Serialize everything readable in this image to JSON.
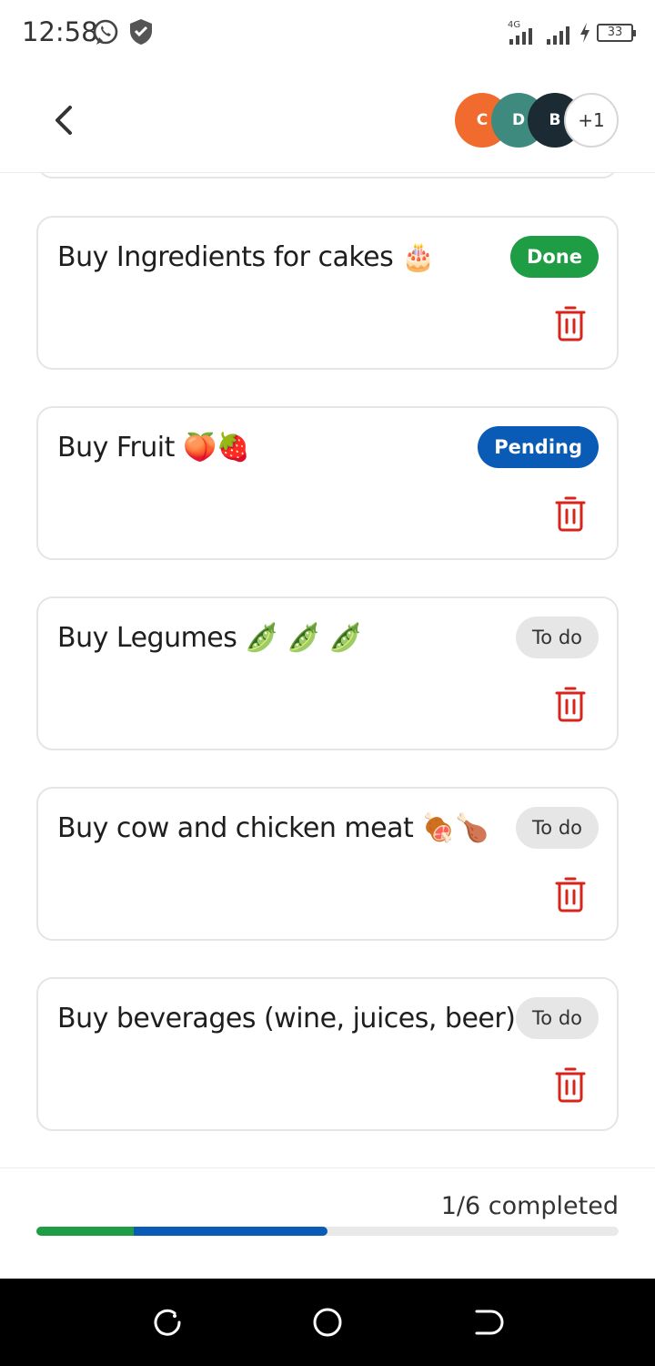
{
  "status_bar": {
    "time": "12:58",
    "network": "4G",
    "battery": "33",
    "icons": [
      "whatsapp-icon",
      "shield-icon",
      "signal-icon",
      "charging-icon",
      "battery-icon"
    ]
  },
  "header": {
    "back_icon": "chevron-left-icon",
    "avatars": [
      {
        "initial": "C",
        "color": "#f26b2e"
      },
      {
        "initial": "D",
        "color": "#3f8a7e"
      },
      {
        "initial": "B",
        "color": "#1b2a33"
      }
    ],
    "more_count": "+1"
  },
  "tasks": [
    {
      "title": "Buy Ingredients for cakes 🎂",
      "status": "Done",
      "status_kind": "done"
    },
    {
      "title": "Buy Fruit 🍑🍓",
      "status": "Pending",
      "status_kind": "pending"
    },
    {
      "title": "Buy Legumes 🫛 🫛 🫛",
      "status": "To do",
      "status_kind": "todo"
    },
    {
      "title": "Buy cow and chicken meat 🍖🍗",
      "status": "To do",
      "status_kind": "todo"
    },
    {
      "title": "Buy beverages (wine, juices, beer) 🍻",
      "status": "To do",
      "status_kind": "todo"
    }
  ],
  "progress": {
    "label": "1/6 completed",
    "done_fraction": 0.167,
    "pending_fraction": 0.333
  },
  "colors": {
    "done": "#1f9d45",
    "pending": "#0a5bb5",
    "todo_bg": "#e6e6e6",
    "delete": "#d9241c"
  }
}
